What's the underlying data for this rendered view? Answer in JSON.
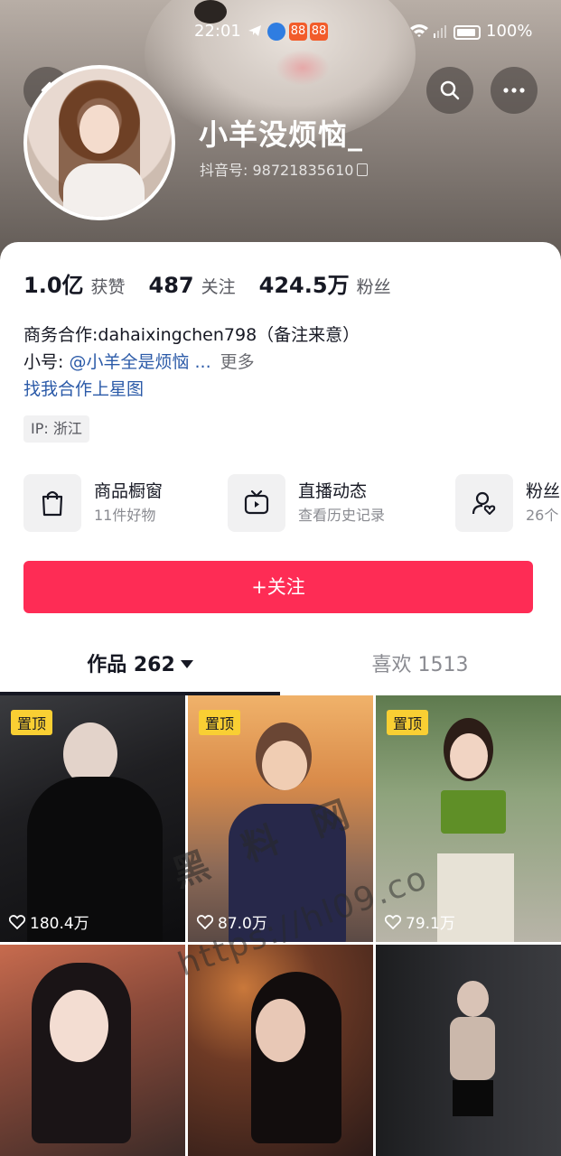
{
  "status_bar": {
    "time": "22:01",
    "battery": "100%",
    "icons": [
      "telegram-icon",
      "browser-icon",
      "app-badge-icon",
      "app-badge-icon",
      "wifi-icon",
      "signal-icon",
      "battery-icon"
    ]
  },
  "profile": {
    "nickname": "小羊没烦恼_",
    "douyin_id_label": "抖音号: ",
    "douyin_id": "98721835610"
  },
  "stats": [
    {
      "value": "1.0亿",
      "label": "获赞"
    },
    {
      "value": "487",
      "label": "关注"
    },
    {
      "value": "424.5万",
      "label": "粉丝"
    }
  ],
  "bio": {
    "line1": "商务合作:dahaixingchen798（备注来意）",
    "line2_prefix": "小号: ",
    "line2_link": "@小羊全是烦恼 ...",
    "line2_more": "更多",
    "line3_link": "找我合作上星图"
  },
  "ip_tag": "IP: 浙江",
  "services": [
    {
      "title": "商品橱窗",
      "subtitle": "11件好物",
      "icon": "shopping-bag-icon"
    },
    {
      "title": "直播动态",
      "subtitle": "查看历史记录",
      "icon": "tv-icon"
    },
    {
      "title": "粉丝",
      "subtitle": "26个",
      "icon": "fans-heart-icon"
    }
  ],
  "follow_button": "+关注",
  "tabs": [
    {
      "label": "作品 262",
      "active": true
    },
    {
      "label": "喜欢 1513",
      "active": false
    }
  ],
  "videos": [
    {
      "pinned": true,
      "pin_label": "置顶",
      "likes": "180.4万"
    },
    {
      "pinned": true,
      "pin_label": "置顶",
      "likes": "87.0万"
    },
    {
      "pinned": true,
      "pin_label": "置顶",
      "likes": "79.1万"
    },
    {
      "pinned": false,
      "likes": ""
    },
    {
      "pinned": false,
      "likes": ""
    },
    {
      "pinned": false,
      "likes": ""
    }
  ],
  "watermark": {
    "line1": "黑 料 网",
    "line2": "https://hl09.co"
  },
  "colors": {
    "accent": "#fe2c55",
    "link": "#2b5aa8",
    "pin": "#f9cf33"
  }
}
